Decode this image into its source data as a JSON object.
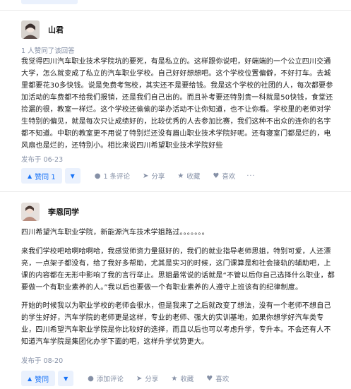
{
  "answers": [
    {
      "author": "山君",
      "liked_by": "1 人赞同了该回答",
      "paragraphs": [
        "我觉得四川汽车职业技术学院坑的要死，有是私立的。这样跟你说吧，好端端的一个公立四川交通大学，怎么就变成了私立的汽车职业学校。自己好好想想吧。这个学校位置偏僻，不好打车。去城里都要花30多快钱。说是免费考驾校，其实还不是要给钱。我是这个学校的社团的人，每次都要参加活动的车费都不给我们报销，还是我们自己出的。而且补考要还特别贵一科就是50快钱，食堂还捡漏的很，教室一样烂。这个学校还偷偷的举办活动不让你知道，也不让你看。学校里的老师对学生特别的偏见，就是每次只让成绩好的，比较优秀的人去参加比赛，我们这种不出众的连你的名字都不知道。中职的教室更不用说了特别烂还没有眉山职业技术学院好呢。还有寝室门都是烂的，电风扇也是烂的，还特别小。相比来说四川希望职业技术学院好些"
      ],
      "date": "发布于 06-23",
      "actions": {
        "upvote": "赞同 1",
        "comments": "1 条评论",
        "share": "分享",
        "collect": "收藏",
        "like": "喜欢",
        "more": "···"
      }
    },
    {
      "author": "李恩同学",
      "paragraphs": [
        "四川希望汽车职业学院，新能源汽车技术学姐路过。。。。。。。",
        "来我们学校吧哈啊哈啊哈，我感觉师资力量挺好的，我们的就业指导老师思姐，特别可爱，人还漂亮，一点架子都没有，给了我好多帮助，尤其是实习的时候，这门课算是和社会接轨的辅助吧，上课的内容都在无形中影响了我的言行举止。思姐最常说的话就是“不管以后你自己选择什么职业，都要做一个有职业素养的人。”我以后也要做一个有职业素养的人遵守上班该有的纪律制度。",
        "开始的时候我以为职业学校的老师会很水，但是我来了之后就改变了想法，没有一个老师不想自己的学生好好，汽车学院的老师更是这样，专业的老师、强大的实训基地，如果你想学好汽车类专业，四川希望汽车职业学院是你比较好的选择，而且以后也可以考虑升学，专升本。不会还有人不知道汽车学院是集团化办学下面的吧，这样升学优势更大。"
      ],
      "date": "发布于 08-20",
      "actions": {
        "upvote": "赞同",
        "comments": "添加评论",
        "share": "分享",
        "collect": "收藏",
        "like": "喜欢"
      }
    }
  ],
  "colors": {
    "accent": "#1772f6",
    "vote_bg": "#eaf1fd",
    "meta": "#8590a6"
  }
}
